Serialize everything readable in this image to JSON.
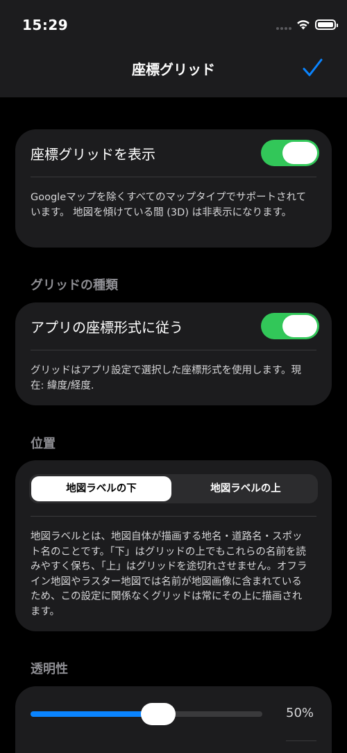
{
  "status": {
    "time": "15:29"
  },
  "nav": {
    "title": "座標グリッド"
  },
  "show_grid": {
    "label": "座標グリッドを表示",
    "enabled": true,
    "description": "Googleマップを除くすべてのマップタイプでサポートされています。 地図を傾けている間 (3D) は非表示になります。"
  },
  "grid_type": {
    "header": "グリッドの種類",
    "label": "アプリの座標形式に従う",
    "enabled": true,
    "description": "グリッドはアプリ設定で選択した座標形式を使用します。現在: 緯度/経度."
  },
  "position": {
    "header": "位置",
    "options": [
      "地図ラベルの下",
      "地図ラベルの上"
    ],
    "selected": "地図ラベルの下",
    "description": "地図ラベルとは、地図自体が描画する地名・道路名・スポット名のことです。「下」はグリッドの上でもこれらの名前を読みやすく保ち、「上」はグリッドを途切れさせません。オフライン地図やラスター地図では名前が地図画像に含まれているため、この設定に関係なくグリッドは常にその上に描画されます。"
  },
  "opacity": {
    "header": "透明性",
    "value": 0.5,
    "value_label": "50%"
  },
  "colors": {
    "toggle_on": "#32c759",
    "accent": "#0a84ff"
  }
}
